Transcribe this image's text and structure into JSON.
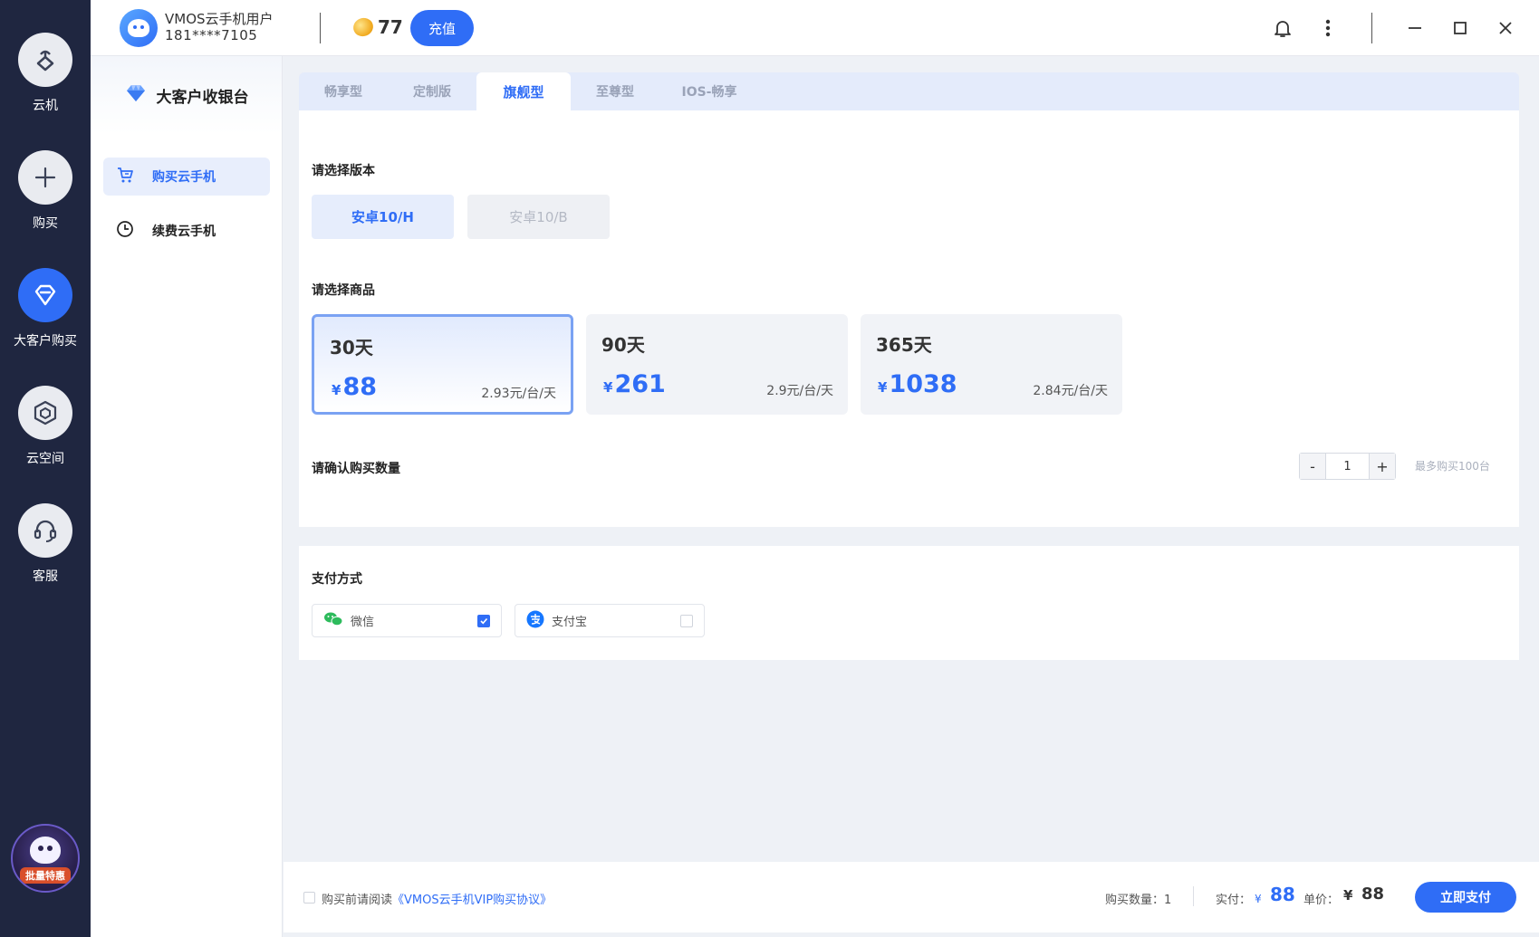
{
  "rail": {
    "items": [
      {
        "label": "云机",
        "icon": "cloud-phone-icon"
      },
      {
        "label": "购买",
        "icon": "plus-icon"
      },
      {
        "label": "大客户购买",
        "icon": "diamond-icon",
        "active": true
      },
      {
        "label": "云空间",
        "icon": "cube-icon"
      },
      {
        "label": "客服",
        "icon": "headset-icon"
      }
    ],
    "promo_badge": "批量特惠"
  },
  "header": {
    "user_name": "VMOS云手机用户",
    "user_phone": "181****7105",
    "coin_count": "77",
    "recharge_label": "充值"
  },
  "sidebar": {
    "title": "大客户收银台",
    "items": [
      {
        "label": "购买云手机",
        "icon": "cart-icon",
        "active": true
      },
      {
        "label": "续费云手机",
        "icon": "clock-icon"
      }
    ]
  },
  "tabs": [
    {
      "label": "畅享型"
    },
    {
      "label": "定制版"
    },
    {
      "label": "旗舰型",
      "active": true
    },
    {
      "label": "至尊型"
    },
    {
      "label": "IOS-畅享"
    }
  ],
  "version": {
    "label": "请选择版本",
    "options": [
      {
        "label": "安卓10/H",
        "active": true
      },
      {
        "label": "安卓10/B",
        "active": false
      }
    ]
  },
  "products": {
    "label": "请选择商品",
    "currency": "¥",
    "items": [
      {
        "days": "30天",
        "price": "88",
        "unit_price": "2.93元/台/天",
        "selected": true
      },
      {
        "days": "90天",
        "price": "261",
        "unit_price": "2.9元/台/天",
        "selected": false
      },
      {
        "days": "365天",
        "price": "1038",
        "unit_price": "2.84元/台/天",
        "selected": false
      }
    ]
  },
  "quantity": {
    "label": "请确认购买数量",
    "minus": "-",
    "value": "1",
    "plus": "+",
    "max_note": "最多购买100台"
  },
  "payment": {
    "label": "支付方式",
    "options": [
      {
        "name": "微信",
        "icon": "wechat-icon",
        "checked": true
      },
      {
        "name": "支付宝",
        "icon": "alipay-icon",
        "checked": false
      }
    ]
  },
  "footer": {
    "agree_prefix": "购买前请阅读",
    "agree_link": "《VMOS云手机VIP购买协议》",
    "qty_text": "购买数量：1",
    "pay_label": "实付：",
    "pay_currency": "¥",
    "pay_amount": "88",
    "unit_label": "单价：",
    "unit_currency": "¥",
    "unit_amount": "88",
    "pay_button": "立即支付"
  },
  "colors": {
    "accent": "#2f6df6",
    "rail_bg": "#1f2640"
  }
}
